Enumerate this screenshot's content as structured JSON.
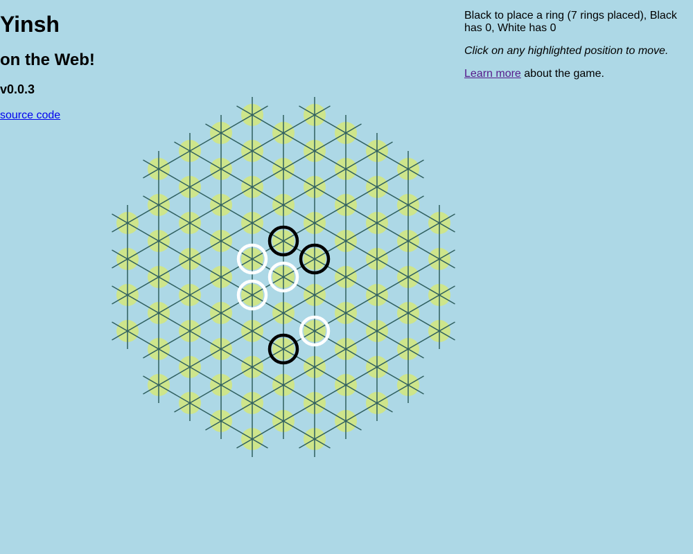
{
  "header": {
    "title": "Yinsh",
    "subtitle": "on the Web!",
    "version": "v0.0.3",
    "source_link": "source code"
  },
  "sidebar": {
    "status": "Black to place a ring (7 rings placed), Black has 0, White has 0",
    "instruction": "Click on any highlighted position to move.",
    "learn_link": "Learn more",
    "learn_suffix": " about the game."
  },
  "board": {
    "colors": {
      "background": "#add8e6",
      "highlight": "#d4e87a",
      "line": "#2f5f5f",
      "black_ring": "#000000",
      "white_ring": "#ffffff"
    },
    "rings": [
      {
        "q": 0,
        "r": -1,
        "color": "black"
      },
      {
        "q": 1,
        "r": -1,
        "color": "black"
      },
      {
        "q": 0,
        "r": 2,
        "color": "black"
      },
      {
        "q": -1,
        "r": 0,
        "color": "white"
      },
      {
        "q": 0,
        "r": 0,
        "color": "white"
      },
      {
        "q": -1,
        "r": 1,
        "color": "white"
      },
      {
        "q": 1,
        "r": 1,
        "color": "white"
      }
    ]
  }
}
